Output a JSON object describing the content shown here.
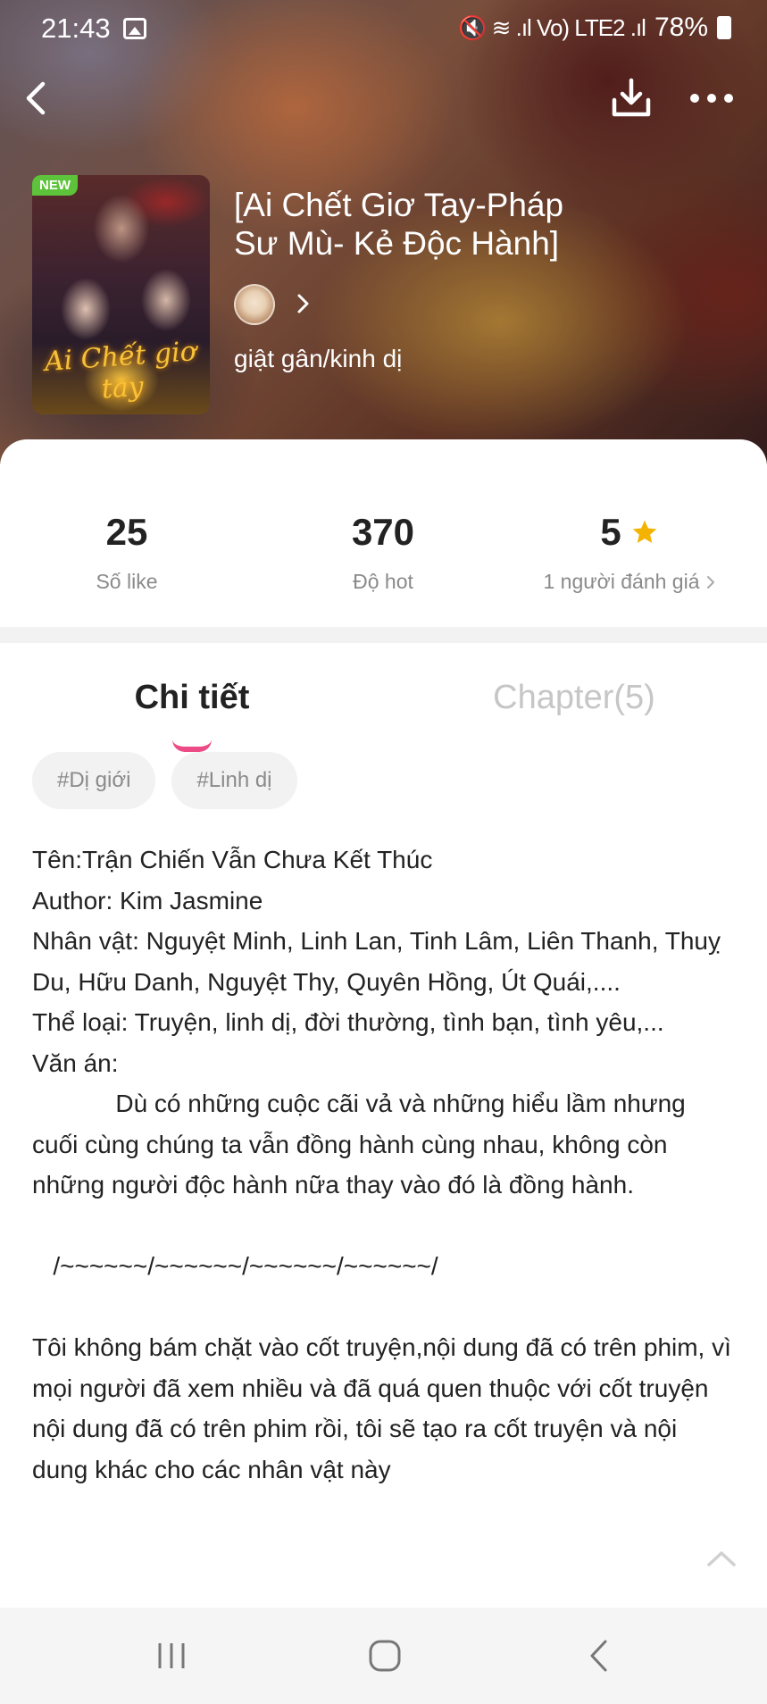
{
  "status_bar": {
    "time": "21:43",
    "signal_glyphs": "🔇 ≋ .ıl Vo) LTE2 .ıl",
    "battery": "78%"
  },
  "header": {
    "new_badge": "NEW",
    "cover_title": "Ai Chết giơ tay",
    "title": "[Ai Chết Giơ Tay-Pháp Sư Mù- Kẻ Độc Hành]",
    "genre": "giật gân/kinh dị"
  },
  "stats": {
    "likes_value": "25",
    "likes_label": "Số like",
    "hot_value": "370",
    "hot_label": "Độ hot",
    "rating_value": "5",
    "rating_label": "1 người đánh giá"
  },
  "tabs": {
    "detail": "Chi tiết",
    "chapters": "Chapter(5)"
  },
  "tags": [
    "#Dị giới",
    "#Linh dị"
  ],
  "description": "Tên:Trận Chiến Vẫn Chưa Kết Thúc\nAuthor: Kim Jasmine\nNhân vật: Nguyệt Minh, Linh Lan, Tinh Lâm, Liên Thanh, Thuỵ Du, Hữu Danh, Nguyệt Thy, Quyên Hồng, Út Quái,....\nThể loại: Truyện, linh dị, đời thường, tình bạn, tình yêu,...\nVăn án:\n            Dù có những cuộc cãi vả và những hiểu lầm nhưng cuối cùng chúng ta vẫn đồng hành cùng nhau, không còn những người độc hành nữa thay vào đó là đồng hành.\n\n   /~~~~~~/~~~~~~/~~~~~~/~~~~~~/\n\nTôi không bám chặt vào cốt truyện,nội dung đã có trên phim, vì mọi người đã xem nhiều và đã quá quen thuộc với cốt truyện nội dung đã có trên phim rồi, tôi sẽ tạo ra cốt truyện và nội dung khác cho các nhân vật này",
  "colors": {
    "accent_pink": "#ec4b86",
    "star": "#f5b301",
    "new_badge": "#5cc33a"
  },
  "icons": {
    "back": "back-arrow-icon",
    "download": "download-icon",
    "more": "more-dots-icon",
    "star": "star-icon",
    "scroll_top": "chevron-up-icon"
  }
}
